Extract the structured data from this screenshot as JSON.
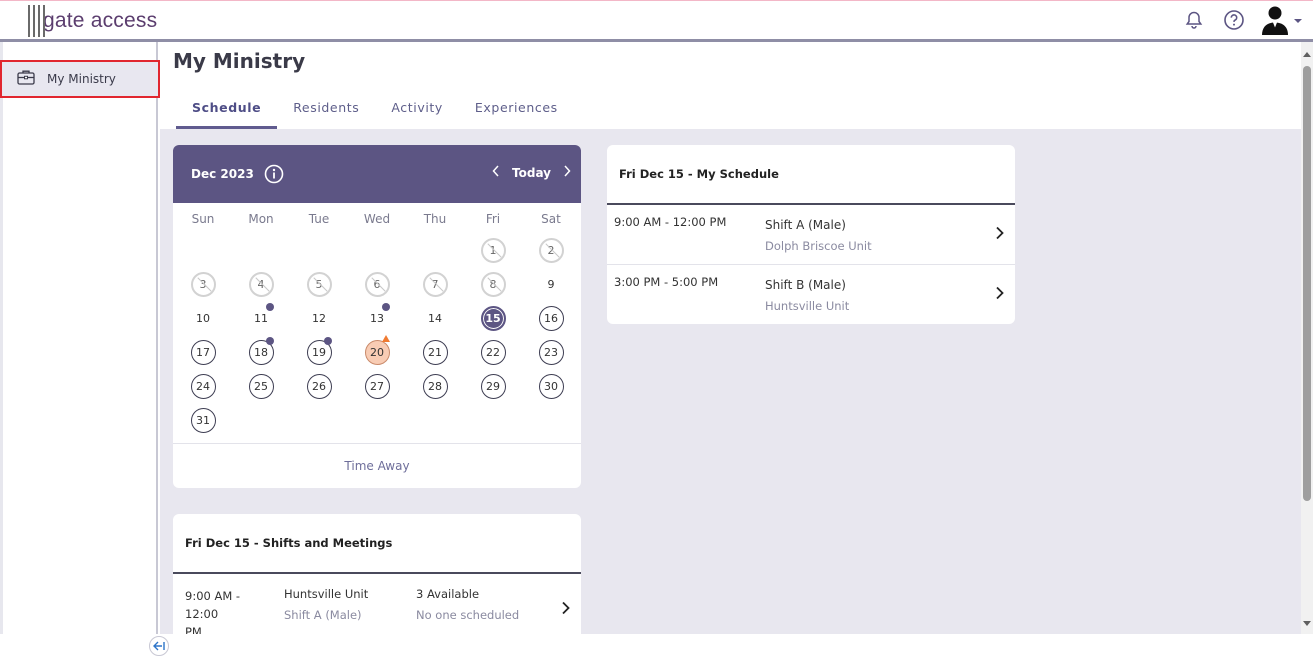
{
  "app": {
    "logo_text": "gate access"
  },
  "sidebar": {
    "items": [
      {
        "label": "My Ministry",
        "icon": "briefcase-icon"
      }
    ]
  },
  "page": {
    "title": "My Ministry",
    "tabs": [
      {
        "label": "Schedule",
        "active": true
      },
      {
        "label": "Residents",
        "active": false
      },
      {
        "label": "Activity",
        "active": false
      },
      {
        "label": "Experiences",
        "active": false
      }
    ]
  },
  "calendar": {
    "month_label": "Dec 2023",
    "today_label": "Today",
    "weekdays": [
      "Sun",
      "Mon",
      "Tue",
      "Wed",
      "Thu",
      "Fri",
      "Sat"
    ],
    "days": [
      null,
      null,
      null,
      null,
      null,
      {
        "d": "1",
        "state": "past"
      },
      {
        "d": "2",
        "state": "past"
      },
      {
        "d": "3",
        "state": "past"
      },
      {
        "d": "4",
        "state": "past"
      },
      {
        "d": "5",
        "state": "past"
      },
      {
        "d": "6",
        "state": "past"
      },
      {
        "d": "7",
        "state": "past"
      },
      {
        "d": "8",
        "state": "past"
      },
      {
        "d": "9",
        "state": "plain"
      },
      {
        "d": "10",
        "state": "plain"
      },
      {
        "d": "11",
        "state": "plain",
        "marker": "dot"
      },
      {
        "d": "12",
        "state": "plain"
      },
      {
        "d": "13",
        "state": "plain",
        "marker": "dot"
      },
      {
        "d": "14",
        "state": "plain"
      },
      {
        "d": "15",
        "state": "today"
      },
      {
        "d": "16",
        "state": "future"
      },
      {
        "d": "17",
        "state": "future"
      },
      {
        "d": "18",
        "state": "future",
        "marker": "dot"
      },
      {
        "d": "19",
        "state": "future",
        "marker": "dot"
      },
      {
        "d": "20",
        "state": "highlight",
        "marker": "triangle"
      },
      {
        "d": "21",
        "state": "future"
      },
      {
        "d": "22",
        "state": "future"
      },
      {
        "d": "23",
        "state": "future"
      },
      {
        "d": "24",
        "state": "future"
      },
      {
        "d": "25",
        "state": "future"
      },
      {
        "d": "26",
        "state": "future"
      },
      {
        "d": "27",
        "state": "future"
      },
      {
        "d": "28",
        "state": "future"
      },
      {
        "d": "29",
        "state": "future"
      },
      {
        "d": "30",
        "state": "future"
      },
      {
        "d": "31",
        "state": "future"
      }
    ],
    "footer_label": "Time Away"
  },
  "my_schedule": {
    "title": "Fri Dec 15 - My Schedule",
    "rows": [
      {
        "time": "9:00 AM - 12:00 PM",
        "name": "Shift A (Male)",
        "unit": "Dolph Briscoe Unit"
      },
      {
        "time": "3:00 PM - 5:00 PM",
        "name": "Shift B (Male)",
        "unit": "Huntsville Unit"
      }
    ]
  },
  "shifts_meetings": {
    "title": "Fri Dec 15 - Shifts and Meetings",
    "rows": [
      {
        "time_line1": "9:00 AM - 12:00",
        "time_line2": "PM",
        "unit": "Huntsville Unit",
        "shift": "Shift A (Male)",
        "available": "3 Available",
        "scheduled": "No one scheduled"
      }
    ]
  },
  "colors": {
    "accent": "#5c5583",
    "highlight_day": "#f8ccb4",
    "marker_triangle": "#f07b32",
    "sidebar_selected_border": "#e1262f"
  }
}
